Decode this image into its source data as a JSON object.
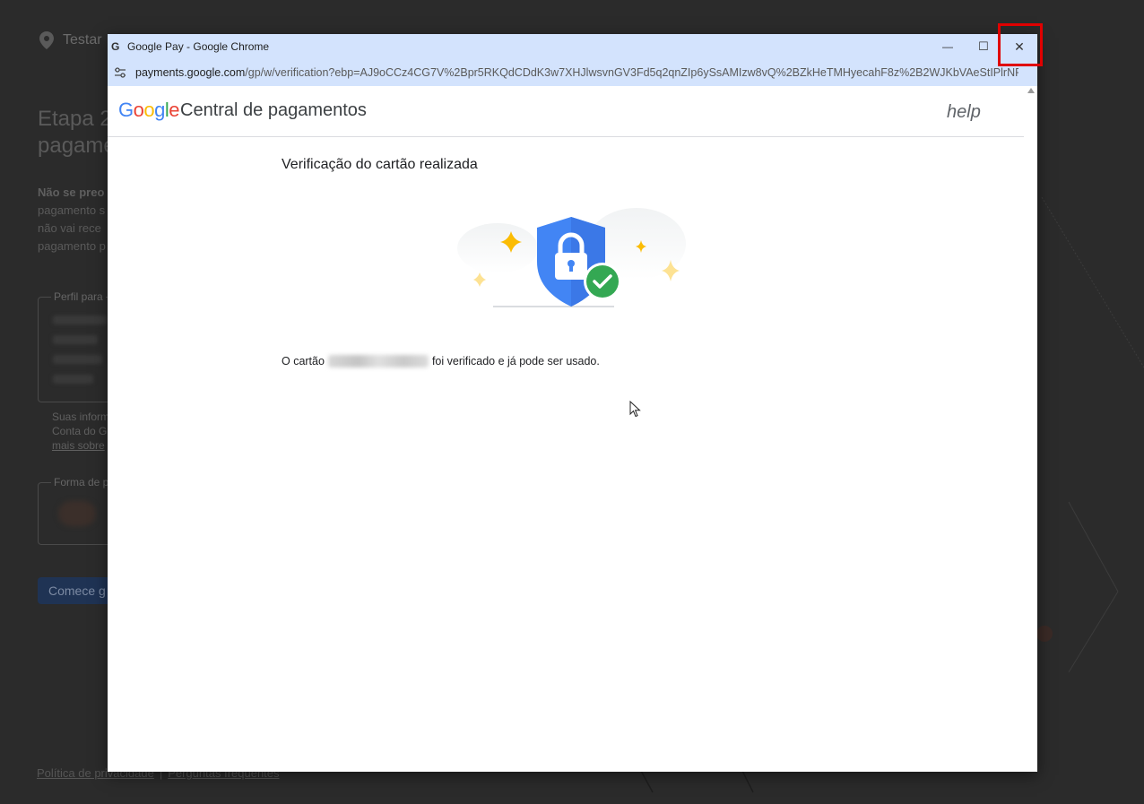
{
  "background_page": {
    "location": "Testar",
    "title_line1": "Etapa 2",
    "title_line2": "pagamen",
    "desc_lines": [
      "Não se preo",
      "pagamento s",
      "não vai rece",
      "pagamento p"
    ],
    "profile_legend": "Perfil para",
    "note_lines": [
      "Suas inform",
      "Conta do G",
      "mais sobre"
    ],
    "payment_legend": "Forma de p",
    "start_button": "Comece g",
    "footer_privacy": "Política de privacidade",
    "footer_separator": "|",
    "footer_faq": "Perguntas frequentes"
  },
  "window": {
    "title": "Google Pay - Google Chrome",
    "title_icon": "G",
    "url_host": "payments.google.com",
    "url_path": "/gp/w/verification?ebp=AJ9oCCz4CG7V%2Bpr5RKQdCDdK3w7XHJlwsvnGV3Fd5q2qnZIp6ySsAMIzw8vQ%2BZkHeTMHyecahF8z%2B2WJKbVAeStIPlrNR3RlwQ...",
    "controls": {
      "minimize": "—",
      "maximize": "☐",
      "close": "✕"
    }
  },
  "page": {
    "logo": {
      "G": "G",
      "o1": "o",
      "o2": "o",
      "g": "g",
      "l": "l",
      "e": "e"
    },
    "product_name": "Central de pagamentos",
    "help_label": "help",
    "heading": "Verificação do cartão realizada",
    "message_before": "O cartão",
    "message_after": "foi verificado e já pode ser usado."
  },
  "colors": {
    "google_blue": "#4285f4",
    "google_red": "#ea4335",
    "google_yellow": "#fbbc05",
    "google_green": "#34a853",
    "chrome_frame": "#d3e3fd",
    "highlight": "#e00000"
  },
  "icons": [
    "location-pin-icon",
    "google-g-icon",
    "minimize-icon",
    "maximize-icon",
    "close-icon",
    "site-settings-icon",
    "shield-lock-check-icon",
    "mouse-cursor-icon"
  ]
}
